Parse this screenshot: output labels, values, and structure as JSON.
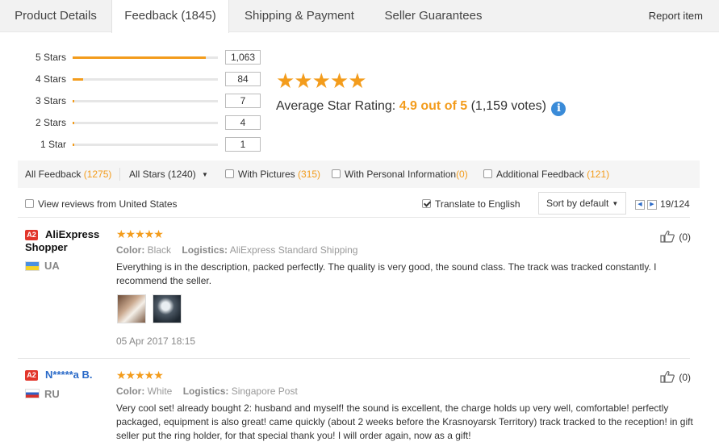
{
  "tabs": [
    {
      "label": "Product Details"
    },
    {
      "label": "Feedback (1845)"
    },
    {
      "label": "Shipping & Payment"
    },
    {
      "label": "Seller Guarantees"
    }
  ],
  "report_label": "Report item",
  "histogram": [
    {
      "label": "5 Stars",
      "count": "1,063",
      "fraction": 0.917
    },
    {
      "label": "4 Stars",
      "count": "84",
      "fraction": 0.072
    },
    {
      "label": "3 Stars",
      "count": "7",
      "fraction": 0.006
    },
    {
      "label": "2 Stars",
      "count": "4",
      "fraction": 0.003
    },
    {
      "label": "1 Star",
      "count": "1",
      "fraction": 0.001
    }
  ],
  "rating": {
    "stars": "★★★★★",
    "label": "Average Star Rating:",
    "score": "4.9 out of 5",
    "votes": "(1,159 votes)",
    "info_icon": "i"
  },
  "filters": {
    "all_feedback": {
      "label": "All Feedback",
      "count": "(1275)"
    },
    "all_stars": {
      "label": "All Stars (1240)",
      "caret": "▼"
    },
    "with_pictures": {
      "label": "With Pictures",
      "count": "(315)"
    },
    "personal_info": {
      "label": "With Personal Information",
      "count": "(0)"
    },
    "additional": {
      "label": "Additional Feedback",
      "count": "(121)"
    }
  },
  "options": {
    "view_us_label": "View reviews from United States",
    "translate_label": "Translate to English",
    "sort_label": "Sort by default",
    "sort_caret": "▼",
    "prev_icon": "◀",
    "next_icon": "▶",
    "page": "19/124"
  },
  "reviews": [
    {
      "badge": "A2",
      "name": "AliExpress Shopper",
      "country": "UA",
      "stars": "★★★★★",
      "color_label": "Color:",
      "color": "Black",
      "logistics_label": "Logistics:",
      "logistics": "AliExpress Standard Shipping",
      "text": "Everything is in the description, packed perfectly. The quality is very good, the sound class. The track was tracked constantly. I recommend the seller.",
      "date": "05 Apr 2017 18:15",
      "helpful": "(0)"
    },
    {
      "badge": "A2",
      "name": "N*****a B.",
      "country": "RU",
      "stars": "★★★★★",
      "color_label": "Color:",
      "color": "White",
      "logistics_label": "Logistics:",
      "logistics": "Singapore Post",
      "text": "Very cool set! already bought 2: husband and myself! the sound is excellent, the charge holds up very well, comfortable! perfectly packaged, equipment is also great! came quickly (about 2 weeks before the Krasnoyarsk Territory) track tracked to the reception! in gift seller put the ring holder, for that special thank you! I will order again, now as a gift!",
      "helpful": "(0)"
    }
  ],
  "colors": {
    "accent": "#f39c1c",
    "link": "#2a6ac8",
    "badge": "#e2362b"
  }
}
